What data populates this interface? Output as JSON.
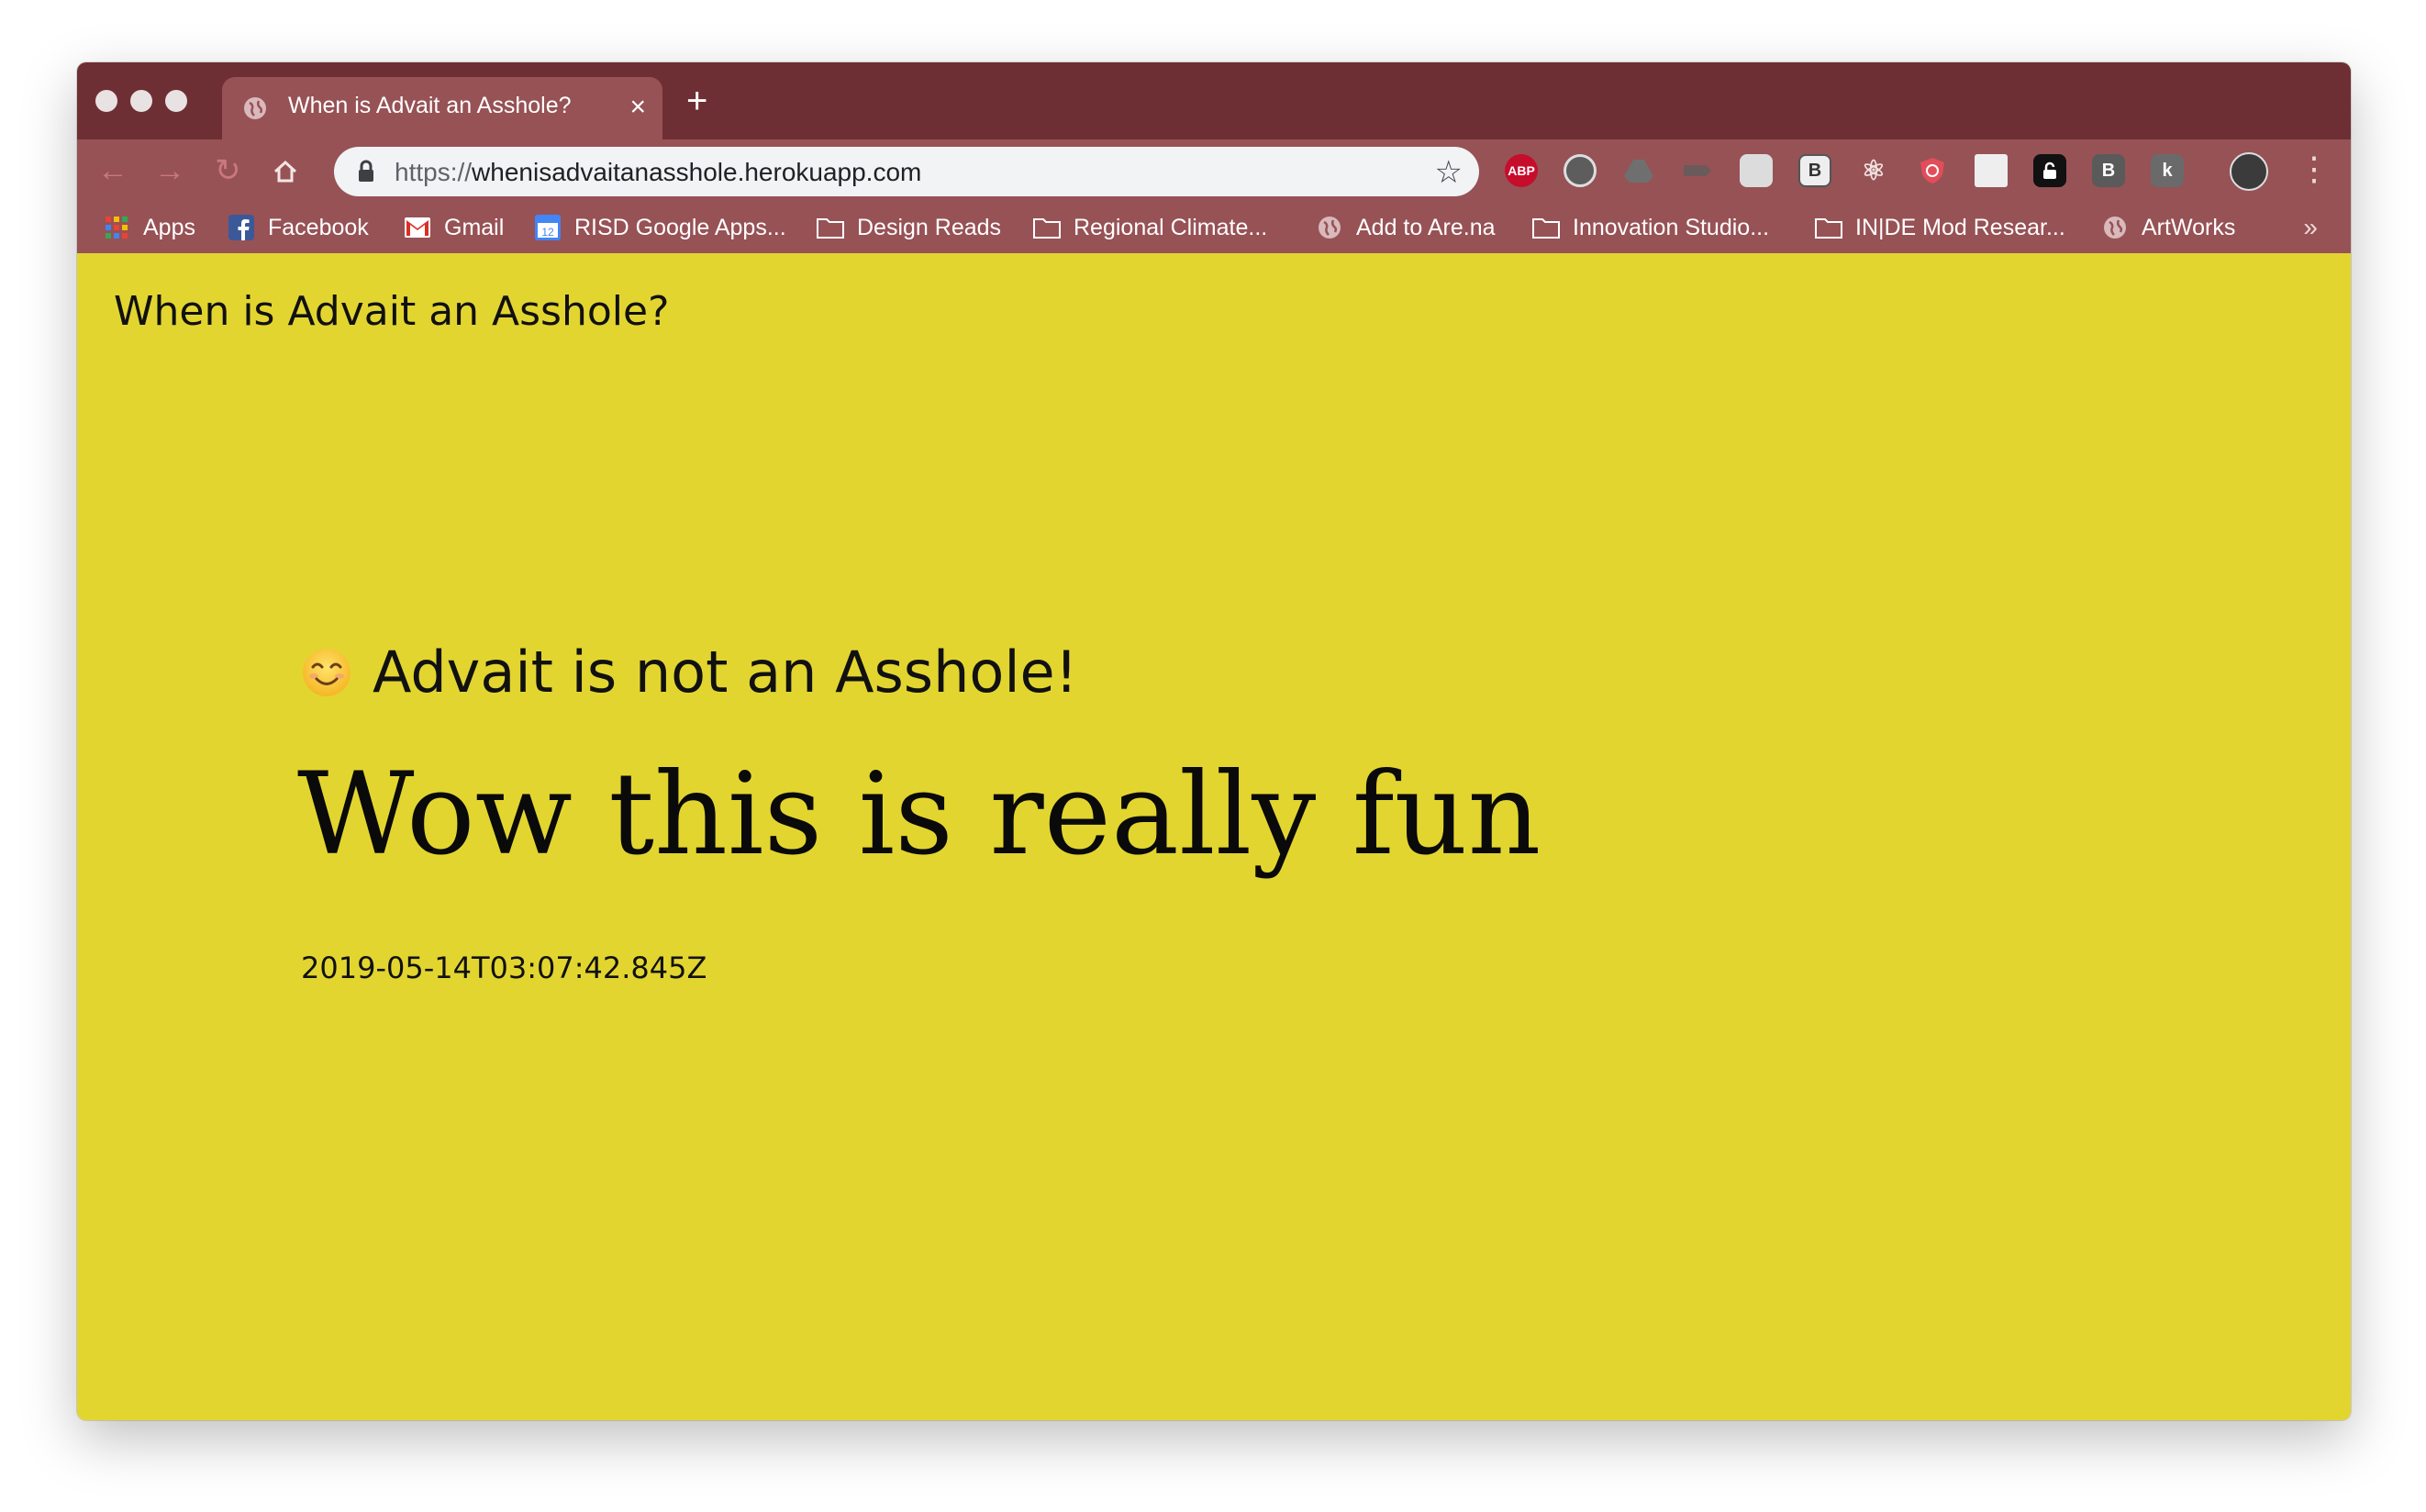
{
  "browser": {
    "tab": {
      "title": "When is Advait an Asshole?",
      "close_icon": "×",
      "new_tab_icon": "+"
    },
    "address_bar": {
      "scheme": "https://",
      "host": "whenisadvaitanasshole.herokuapp.com"
    },
    "extensions": [
      {
        "name": "adblock-plus-icon",
        "label": "ABP",
        "color": "#c70d2c"
      },
      {
        "name": "record-icon",
        "label": "",
        "color": "#5d5d5d"
      },
      {
        "name": "drive-icon",
        "label": "",
        "color": "#7a7a7a"
      },
      {
        "name": "tag-icon",
        "label": "",
        "color": "#6b6b6b"
      },
      {
        "name": "note-icon",
        "label": "",
        "color": "#dcdcdc"
      },
      {
        "name": "b-box-icon",
        "label": "B",
        "color": "#eeeeee"
      },
      {
        "name": "react-icon",
        "label": "⚛",
        "color": "#975256"
      },
      {
        "name": "shield-icon",
        "label": "",
        "color": "#e24d5a"
      },
      {
        "name": "layout-icon",
        "label": "",
        "color": "#eeeeee"
      },
      {
        "name": "lock-ext-icon",
        "label": "",
        "color": "#111111"
      },
      {
        "name": "b-ext-icon",
        "label": "B",
        "color": "#5a5a5a"
      },
      {
        "name": "k-ext-icon",
        "label": "k",
        "color": "#6a6a6a"
      }
    ]
  },
  "bookmarks": [
    {
      "label": "Apps",
      "icon": "apps-grid-icon"
    },
    {
      "label": "Facebook",
      "icon": "facebook-icon"
    },
    {
      "label": "Gmail",
      "icon": "gmail-icon"
    },
    {
      "label": "RISD Google Apps...",
      "icon": "calendar-icon"
    },
    {
      "label": "Design Reads",
      "icon": "folder-icon"
    },
    {
      "label": "Regional Climate...",
      "icon": "folder-icon"
    },
    {
      "label": "Add to Are.na",
      "icon": "globe-icon"
    },
    {
      "label": "Innovation Studio...",
      "icon": "folder-icon"
    },
    {
      "label": "IN|DE Mod Resear...",
      "icon": "folder-icon"
    },
    {
      "label": "ArtWorks",
      "icon": "globe-icon"
    }
  ],
  "bookmarks_more": "»",
  "page": {
    "site_title": "When is Advait an Asshole?",
    "status": "Advait is not an Asshole!",
    "status_icon": "smiling-face-emoji",
    "headline": "Wow this is really fun",
    "timestamp": "2019-05-14T03:07:42.845Z",
    "background_color": "#e3d530"
  },
  "colors": {
    "tabstrip": "#6e2f34",
    "toolbar": "#975256"
  }
}
